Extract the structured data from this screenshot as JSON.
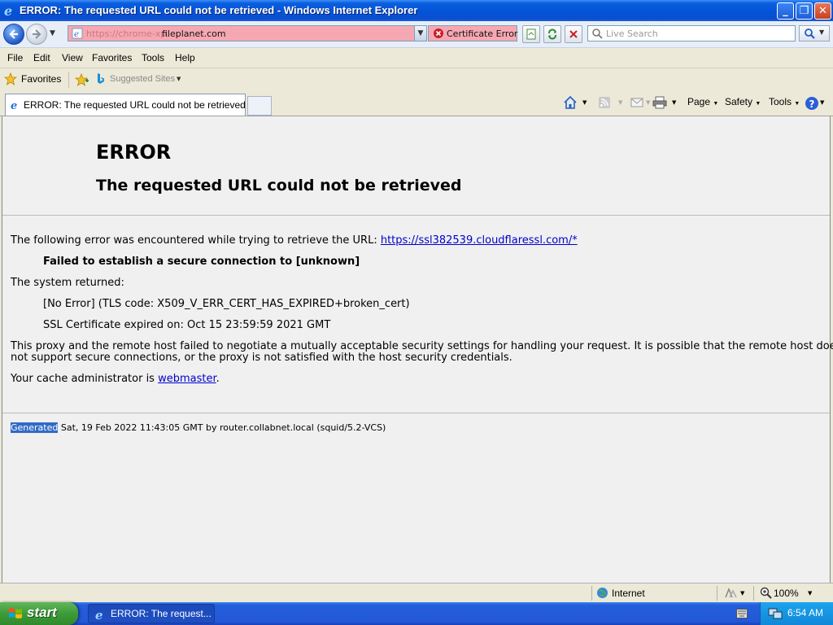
{
  "window": {
    "title": "ERROR: The requested URL could not be retrieved - Windows Internet Explorer",
    "minimize": "_",
    "restore": "❐",
    "close": "✕"
  },
  "address": {
    "protocol_text": "https://chrome-xp.",
    "host_text": "fileplanet.com",
    "cert_error_label": "Certificate Error",
    "search_placeholder": "Live Search",
    "bar_color": "#f6a8b2"
  },
  "menu": [
    "File",
    "Edit",
    "View",
    "Favorites",
    "Tools",
    "Help"
  ],
  "favorites": {
    "label": "Favorites",
    "suggested_sites": "Suggested Sites"
  },
  "tab": {
    "active_label": "ERROR: The requested URL could not be retrieved"
  },
  "commandbar": {
    "page": "Page",
    "safety": "Safety",
    "tools": "Tools"
  },
  "content": {
    "error_title": "ERROR",
    "error_subtitle": "The requested URL could not be retrieved",
    "line1_prefix": "The following error was encountered while trying to retrieve the URL: ",
    "line1_link": "https://ssl382539.cloudflaressl.com/*",
    "failed_msg": "Failed to establish a secure connection to [unknown]",
    "system_returned": "The system returned:",
    "tls_code": "[No Error] (TLS code: X509_V_ERR_CERT_HAS_EXPIRED+broken_cert)",
    "ssl_expired": "SSL Certificate expired on: Oct 15 23:59:59 2021 GMT",
    "proxy_msg_1": "This proxy and the remote host failed to negotiate a mutually acceptable security settings for handling your request. It is possible that the remote host does",
    "proxy_msg_2": "not support secure connections, or the proxy is not satisfied with the host security credentials.",
    "admin_prefix": "Your cache administrator is ",
    "admin_link": "webmaster",
    "admin_suffix": ".",
    "footer_highlight": "Generated",
    "footer_rest": " Sat, 19 Feb 2022 11:43:05 GMT by router.collabnet.local (squid/5.2-VCS)"
  },
  "status": {
    "zone": "Internet",
    "zoom": "100%"
  },
  "taskbar": {
    "start": "start",
    "task_label": "ERROR: The request...",
    "clock": "6:54 AM"
  }
}
